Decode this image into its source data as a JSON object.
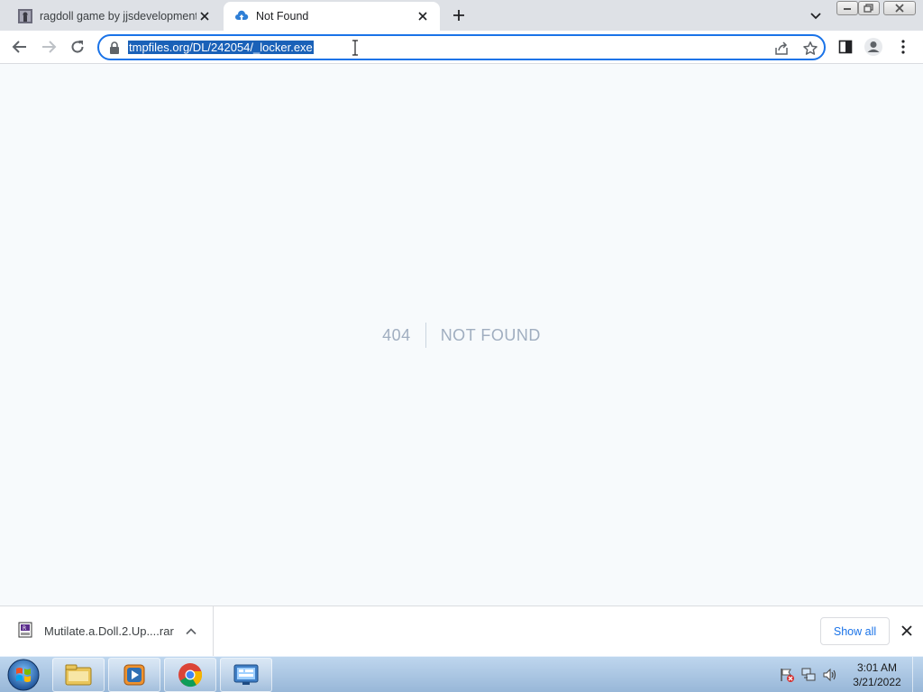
{
  "browser": {
    "tabs": [
      {
        "title": "ragdoll game by jjsdevelopments",
        "favicon": "ragdoll-favicon",
        "active": false
      },
      {
        "title": "Not Found",
        "favicon": "cloud-upload-icon",
        "active": true
      }
    ],
    "address_bar": {
      "url": "tmpfiles.org/DL/242054/_locker.exe",
      "selected": true
    }
  },
  "page": {
    "error_code": "404",
    "error_message": "NOT FOUND"
  },
  "download_shelf": {
    "item_name": "Mutilate.a.Doll.2.Up....rar",
    "show_all_label": "Show all"
  },
  "taskbar": {
    "apps": [
      "windows-explorer-icon",
      "media-player-icon",
      "chrome-icon",
      "control-panel-icon"
    ],
    "clock_time": "3:01 AM",
    "clock_date": "3/21/2022"
  },
  "colors": {
    "accent": "#1a73e8",
    "selection": "#1a61b8",
    "error_text": "#a0aec0",
    "page_bg": "#f7fafc"
  }
}
